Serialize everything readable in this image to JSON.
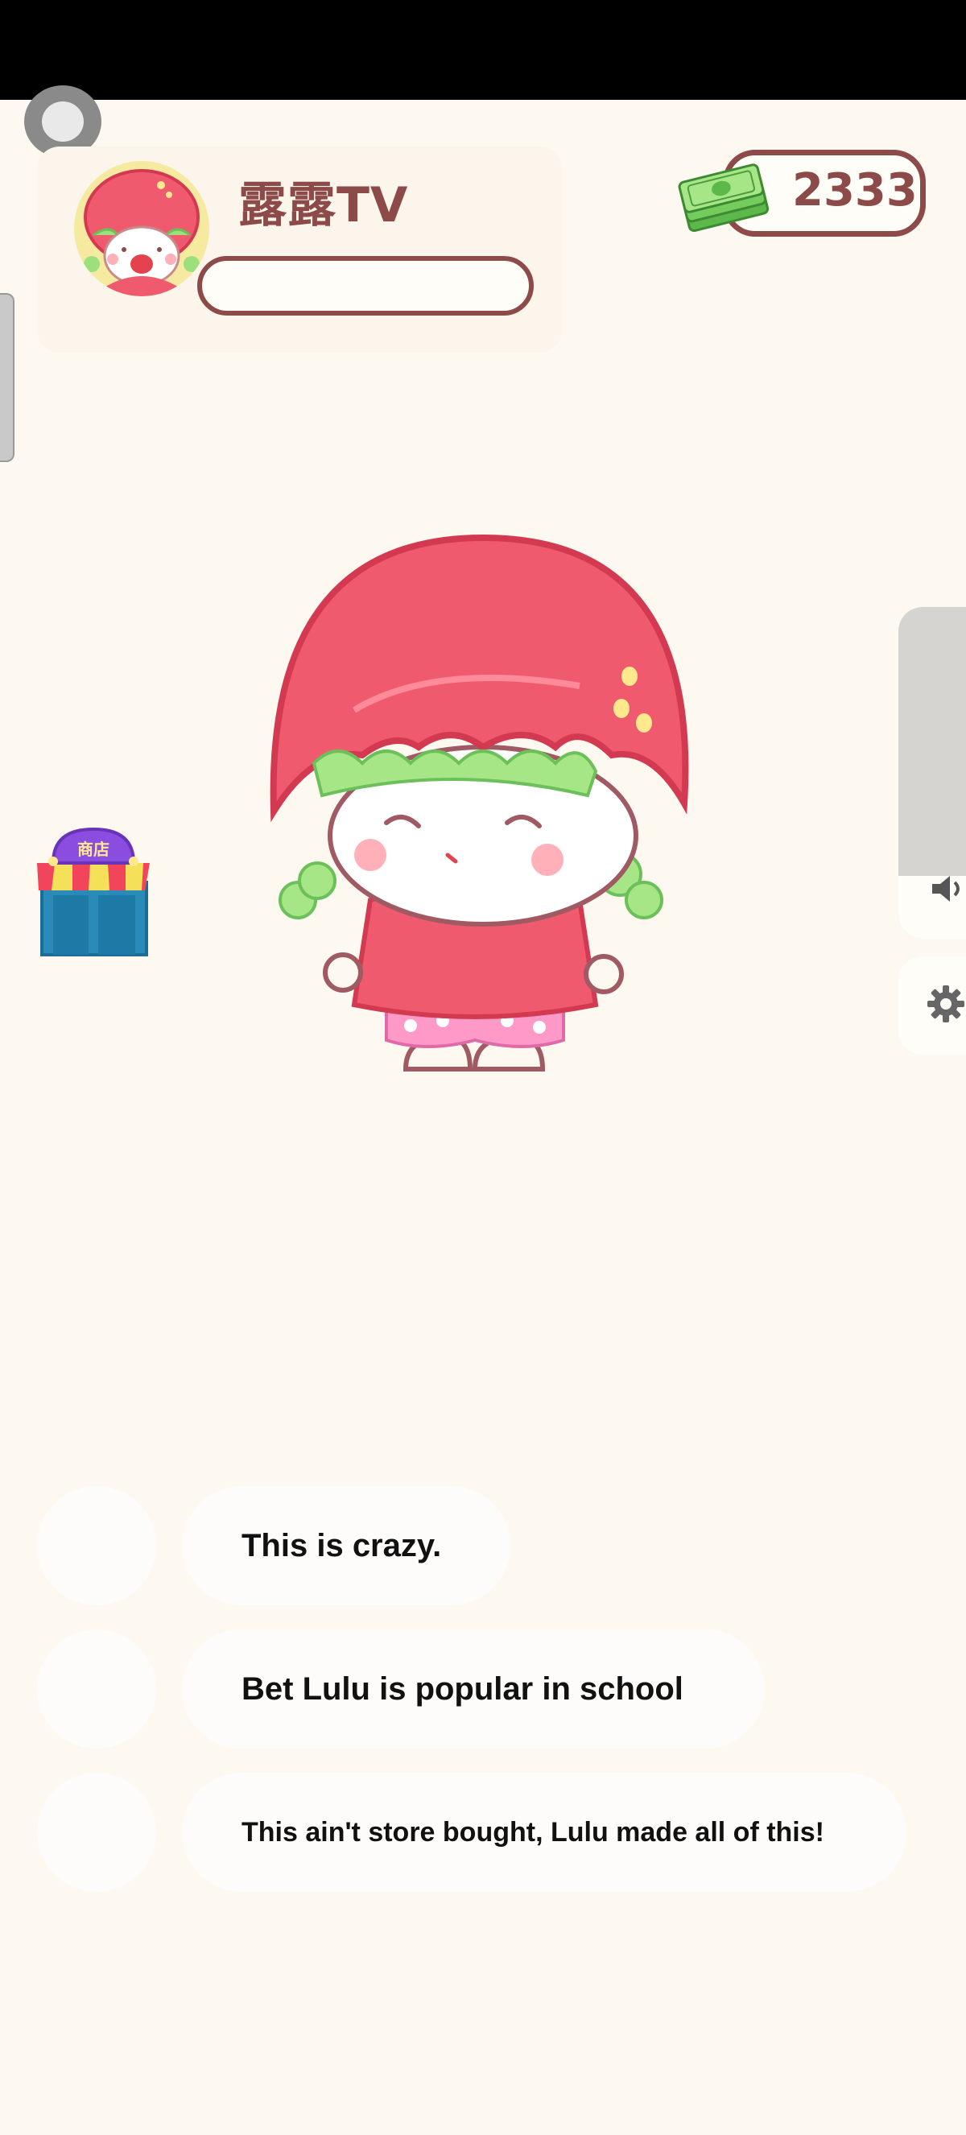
{
  "profile": {
    "name": "露露TV",
    "avatar_icon": "strawberry-girl-avatar-icon"
  },
  "currency": {
    "icon": "cash-stack-icon",
    "value": "2333"
  },
  "shop": {
    "icon": "shop-storefront-icon",
    "sign": "商店"
  },
  "side_controls": {
    "volume_icon": "volume-icon",
    "settings_icon": "gear-icon"
  },
  "comments": [
    {
      "text": "This is crazy."
    },
    {
      "text": "Bet Lulu  is popular in school"
    },
    {
      "text": "This ain't store bought, Lulu  made all of this!"
    }
  ],
  "colors": {
    "background": "#fdf9f1",
    "accent_brown": "#8c4a48",
    "strawberry_red": "#f05a6e",
    "hair_green": "#9be07a"
  }
}
